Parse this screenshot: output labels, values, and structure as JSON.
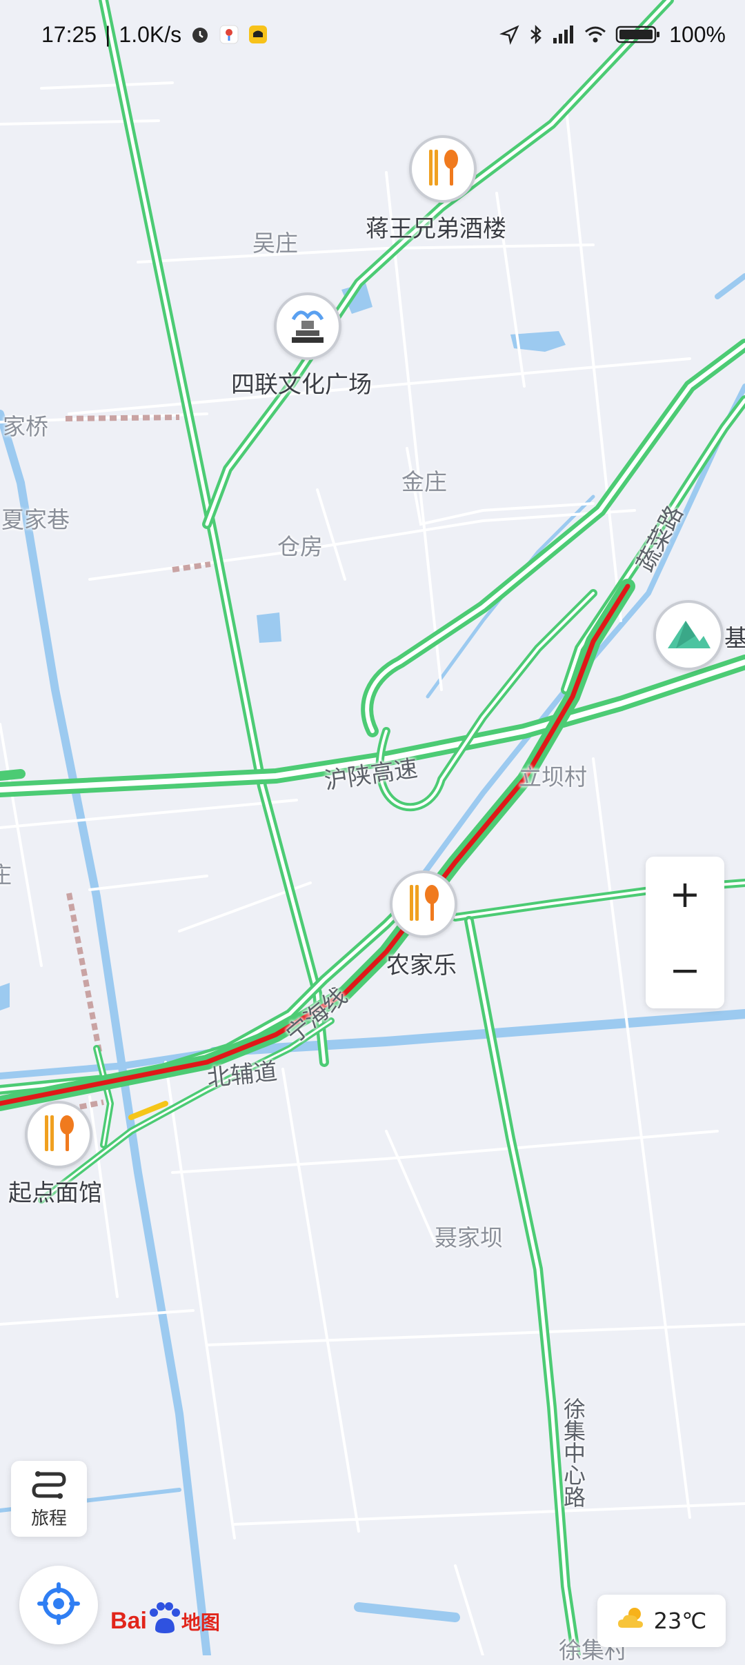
{
  "status_bar": {
    "time": "17:25",
    "speed": "1.0K/s",
    "battery": "100%",
    "icons": [
      "alarm-icon",
      "map-pin-app-icon",
      "car-app-icon",
      "location-arrow-icon",
      "bluetooth-icon",
      "signal-icon",
      "wifi-icon",
      "battery-icon"
    ]
  },
  "map": {
    "place_labels": [
      {
        "id": "wuzhuang",
        "text": "吴庄"
      },
      {
        "id": "jiajiaqiao",
        "text": "家桥"
      },
      {
        "id": "xiajiaxiang",
        "text": "夏家巷"
      },
      {
        "id": "jinzhuang",
        "text": "金庄"
      },
      {
        "id": "cangfang",
        "text": "仓房"
      },
      {
        "id": "libacun",
        "text": "立坝村"
      },
      {
        "id": "niejiaba",
        "text": "聂家坝"
      },
      {
        "id": "xujicun",
        "text": "徐集村"
      },
      {
        "id": "edge-zhuang",
        "text": "庄"
      }
    ],
    "road_labels": [
      {
        "id": "hushan-expressway",
        "text": "沪陕高速"
      },
      {
        "id": "ninghai-line",
        "text": "宁海线"
      },
      {
        "id": "north-service-road",
        "text": "北辅道"
      },
      {
        "id": "xuji-center-road",
        "text": "徐集中心路"
      },
      {
        "id": "northeast-road",
        "text": "蔬菜路"
      }
    ],
    "pois": [
      {
        "id": "jiangwang-restaurant",
        "name": "蒋王兄弟酒楼",
        "icon": "restaurant-icon"
      },
      {
        "id": "silian-plaza",
        "name": "四联文化广场",
        "icon": "fountain-icon"
      },
      {
        "id": "nongjiale",
        "name": "农家乐",
        "icon": "restaurant-icon"
      },
      {
        "id": "qidian-noodle",
        "name": "起点面馆",
        "icon": "restaurant-icon"
      },
      {
        "id": "base",
        "name": "基",
        "icon": "mountain-icon"
      }
    ]
  },
  "controls": {
    "zoom_in": "+",
    "zoom_out": "−",
    "route_label": "旅程",
    "weather_temp": "23℃",
    "logo_text_1": "Bai",
    "logo_text_2": "地图"
  },
  "colors": {
    "background": "#eef0f6",
    "road_clear": "#4ccb74",
    "road_congested": "#e01818",
    "road_slow": "#f5c518",
    "water": "#8cc4ef",
    "accent": "#2f7ef3"
  }
}
